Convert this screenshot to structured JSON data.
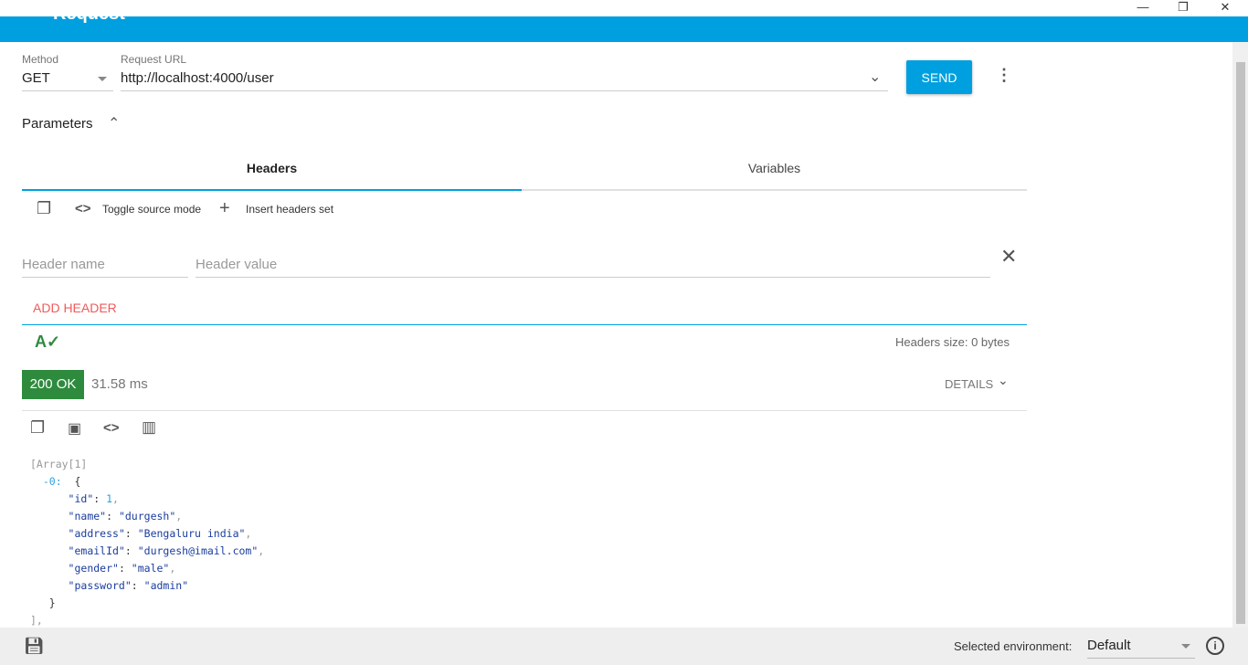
{
  "window": {
    "minimize": "—",
    "restore": "❐",
    "close": "✕"
  },
  "appbar": {
    "title": "Request"
  },
  "request": {
    "method_label": "Method",
    "method": "GET",
    "url_label": "Request URL",
    "url": "http://localhost:4000/user",
    "send_label": "SEND"
  },
  "parameters": {
    "label": "Parameters",
    "tabs": [
      {
        "label": "Headers",
        "active": true
      },
      {
        "label": "Variables",
        "active": false
      }
    ],
    "toolbar": {
      "toggle_source": "Toggle source mode",
      "insert_headers": "Insert headers set"
    },
    "header_name_placeholder": "Header name",
    "header_value_placeholder": "Header value",
    "add_header": "ADD HEADER",
    "headers_size": "Headers size: 0 bytes"
  },
  "response": {
    "status": "200 OK",
    "status_color": "#2e8b3e",
    "time": "31.58 ms",
    "details": "DETAILS",
    "json": {
      "array_label": "[Array[1]",
      "index": "-0:",
      "open": "{",
      "close": "}",
      "end": "],",
      "fields": [
        {
          "key": "\"id\"",
          "value": "1",
          "type": "number"
        },
        {
          "key": "\"name\"",
          "value": "\"durgesh\"",
          "type": "string"
        },
        {
          "key": "\"address\"",
          "value": "\"Bengaluru india\"",
          "type": "string"
        },
        {
          "key": "\"emailId\"",
          "value": "\"durgesh@imail.com\"",
          "type": "string"
        },
        {
          "key": "\"gender\"",
          "value": "\"male\"",
          "type": "string"
        },
        {
          "key": "\"password\"",
          "value": "\"admin\"",
          "type": "string"
        }
      ]
    }
  },
  "footer": {
    "env_label": "Selected environment:",
    "env_value": "Default"
  },
  "colors": {
    "accent": "#00a0e0",
    "add_header": "#f05a5a"
  }
}
